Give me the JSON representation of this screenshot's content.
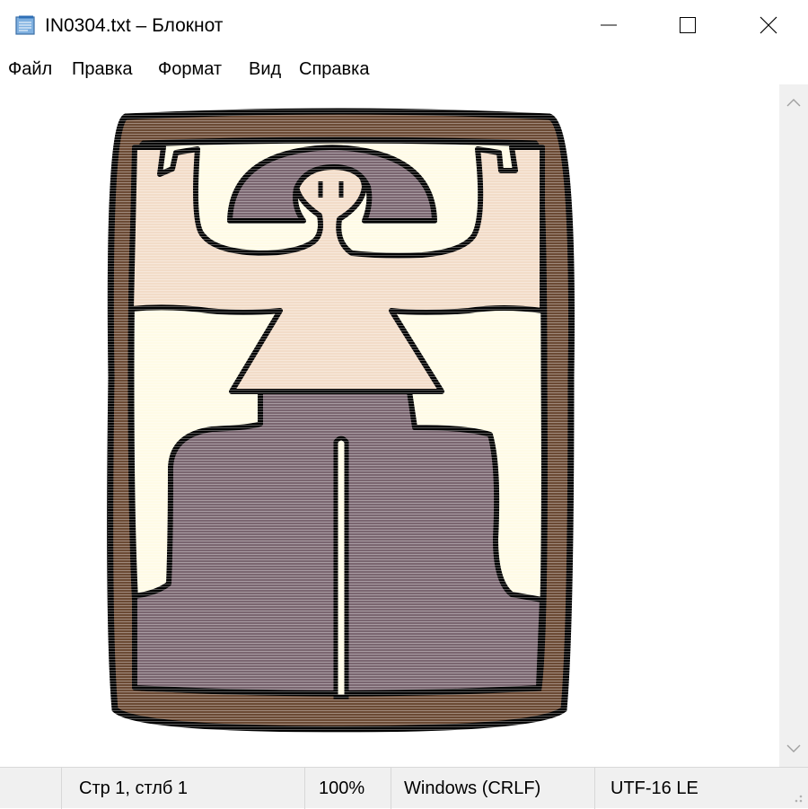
{
  "window": {
    "title": "IN0304.txt – Блокнот",
    "icon": "notepad-icon",
    "controls": [
      "minimize-icon",
      "maximize-icon",
      "close-icon"
    ]
  },
  "menu": {
    "items": [
      {
        "label": "Файл"
      },
      {
        "label": "Правка"
      },
      {
        "label": "Формат"
      },
      {
        "label": "Вид"
      },
      {
        "label": "Справка"
      }
    ]
  },
  "document": {
    "content": "ASCII-art style picture: a figure with raised arms in a brown frame",
    "colors": {
      "frame": "#6b4a34",
      "background": "#fffbe6",
      "skin": "#f2dcc8",
      "clothing": "#7a6670",
      "outline": "#000000"
    }
  },
  "status": {
    "position": "Стр 1, стлб 1",
    "zoom": "100%",
    "line_endings": "Windows (CRLF)",
    "encoding": "UTF-16 LE"
  }
}
